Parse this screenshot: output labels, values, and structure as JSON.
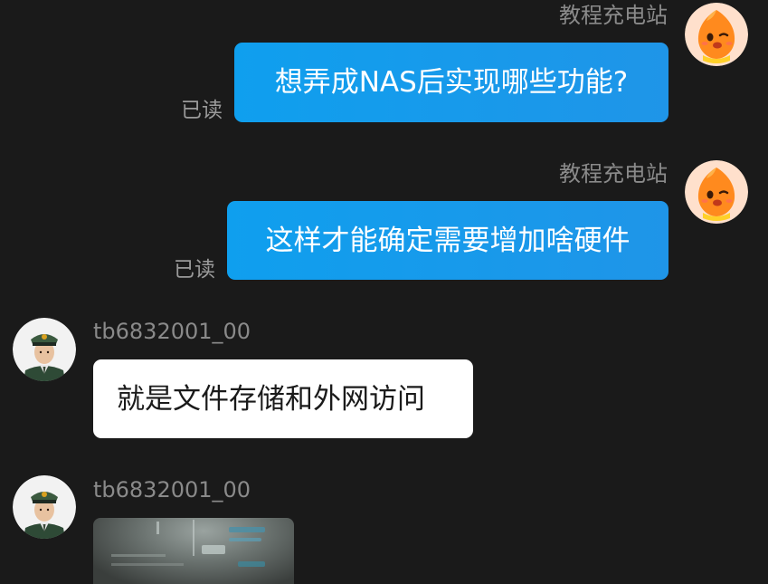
{
  "messages": [
    {
      "sender": "教程充电站",
      "text": "想弄成NAS后实现哪些功能?",
      "status": "已读"
    },
    {
      "sender": "教程充电站",
      "text": "这样才能确定需要增加啥硬件",
      "status": "已读"
    },
    {
      "sender": "tb6832001_00",
      "text": "就是文件存储和外网访问"
    },
    {
      "sender": "tb6832001_00",
      "attachment": "image"
    }
  ],
  "colors": {
    "background": "#1a1a1a",
    "outgoing_bubble": "#1a9cee",
    "incoming_bubble": "#ffffff",
    "name_text": "#8a8a8a",
    "read_text": "#9a9a9a"
  },
  "icons": {
    "seller_avatar": "orange-mascot-avatar",
    "buyer_avatar": "uniform-portrait-avatar"
  }
}
